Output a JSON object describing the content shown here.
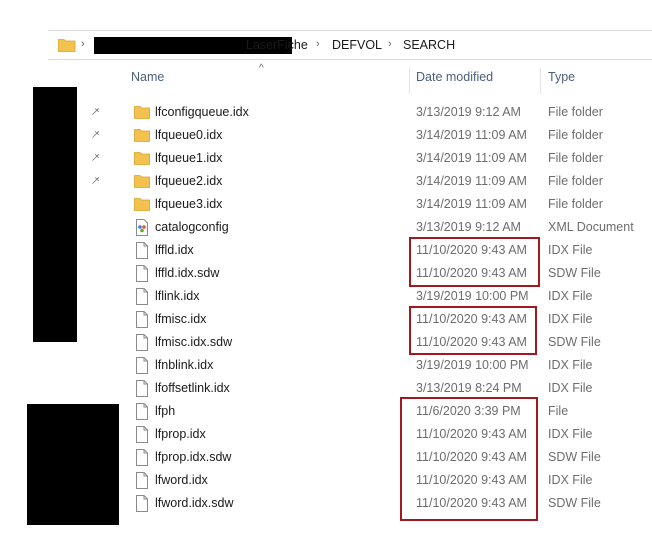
{
  "address": {
    "crumbs": [
      "LaserFiche",
      "DEFVOL",
      "SEARCH"
    ],
    "separator": "›"
  },
  "columns": {
    "name": "Name",
    "date": "Date modified",
    "type": "Type"
  },
  "files": [
    {
      "name": "lfconfigqueue.idx",
      "date": "3/13/2019 9:12 AM",
      "type": "File folder",
      "icon": "folder-icon",
      "pinned": true
    },
    {
      "name": "lfqueue0.idx",
      "date": "3/14/2019 11:09 AM",
      "type": "File folder",
      "icon": "folder-icon",
      "pinned": true
    },
    {
      "name": "lfqueue1.idx",
      "date": "3/14/2019 11:09 AM",
      "type": "File folder",
      "icon": "folder-icon",
      "pinned": true
    },
    {
      "name": "lfqueue2.idx",
      "date": "3/14/2019 11:09 AM",
      "type": "File folder",
      "icon": "folder-icon",
      "pinned": true
    },
    {
      "name": "lfqueue3.idx",
      "date": "3/14/2019 11:09 AM",
      "type": "File folder",
      "icon": "folder-icon",
      "pinned": false
    },
    {
      "name": "catalogconfig",
      "date": "3/13/2019 9:12 AM",
      "type": "XML Document",
      "icon": "xml-file-icon",
      "pinned": false
    },
    {
      "name": "lffld.idx",
      "date": "11/10/2020 9:43 AM",
      "type": "IDX File",
      "icon": "file-icon",
      "pinned": false
    },
    {
      "name": "lffld.idx.sdw",
      "date": "11/10/2020 9:43 AM",
      "type": "SDW File",
      "icon": "file-icon",
      "pinned": false
    },
    {
      "name": "lflink.idx",
      "date": "3/19/2019 10:00 PM",
      "type": "IDX File",
      "icon": "file-icon",
      "pinned": false
    },
    {
      "name": "lfmisc.idx",
      "date": "11/10/2020 9:43 AM",
      "type": "IDX File",
      "icon": "file-icon",
      "pinned": false
    },
    {
      "name": "lfmisc.idx.sdw",
      "date": "11/10/2020 9:43 AM",
      "type": "SDW File",
      "icon": "file-icon",
      "pinned": false
    },
    {
      "name": "lfnblink.idx",
      "date": "3/19/2019 10:00 PM",
      "type": "IDX File",
      "icon": "file-icon",
      "pinned": false
    },
    {
      "name": "lfoffsetlink.idx",
      "date": "3/13/2019 8:24 PM",
      "type": "IDX File",
      "icon": "file-icon",
      "pinned": false
    },
    {
      "name": "lfph",
      "date": "11/6/2020 3:39 PM",
      "type": "File",
      "icon": "file-icon",
      "pinned": false
    },
    {
      "name": "lfprop.idx",
      "date": "11/10/2020 9:43 AM",
      "type": "IDX File",
      "icon": "file-icon",
      "pinned": false
    },
    {
      "name": "lfprop.idx.sdw",
      "date": "11/10/2020 9:43 AM",
      "type": "SDW File",
      "icon": "file-icon",
      "pinned": false
    },
    {
      "name": "lfword.idx",
      "date": "11/10/2020 9:43 AM",
      "type": "IDX File",
      "icon": "file-icon",
      "pinned": false
    },
    {
      "name": "lfword.idx.sdw",
      "date": "11/10/2020 9:43 AM",
      "type": "SDW File",
      "icon": "file-icon",
      "pinned": false
    }
  ],
  "colors": {
    "highlight": "#a3171f",
    "folder": "#f2c14e",
    "header_text": "#4c607a",
    "meta_text": "#6d6d6d"
  }
}
